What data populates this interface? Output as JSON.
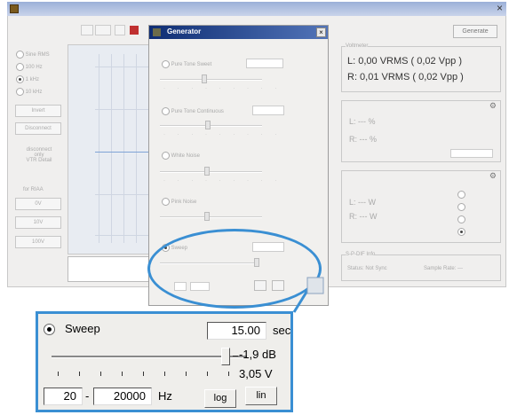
{
  "main_window": {
    "left_panel": {
      "radio_items": [
        "Sine RMS",
        "100 Hz",
        "1 kHz",
        "10 kHz"
      ],
      "buttons": [
        "Invert",
        "Disconnect"
      ],
      "text_lines": [
        "disconnect",
        "only",
        "VTR Detail",
        "for  RIAA"
      ],
      "level_buttons": [
        "0V",
        "10V",
        "100V"
      ]
    },
    "generate_button": "Generate",
    "voltmeter": {
      "group_label": "Voltmeter",
      "left_line": "L: 0,00 VRMS ( 0,02 Vpp )",
      "right_line": "R: 0,01 VRMS ( 0,02 Vpp )"
    },
    "status_group": {
      "label": "S-P-DIF Info",
      "status_text": "Status: Not Sync",
      "sample_rate_text": "Sample Rate: ---"
    }
  },
  "generator_dialog": {
    "title": "Generator",
    "options": [
      "Pure Tone Sweet",
      "Pure Tone Continuous",
      "White Noise",
      "Pink Noise",
      "Sweep"
    ]
  },
  "zoom": {
    "sweep_label": "Sweep",
    "duration_value": "15.00",
    "duration_unit": "sec",
    "db_value": "-1,9 dB",
    "volt_value": "3,05 V",
    "freq_from": "20",
    "separator": "-",
    "freq_to": "20000",
    "freq_unit": "Hz",
    "log_button": "log",
    "lin_button": "lin",
    "slider_level": 0.89
  }
}
